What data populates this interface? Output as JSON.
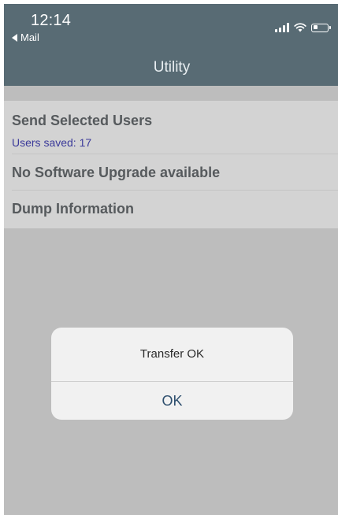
{
  "status_bar": {
    "time": "12:14",
    "back_app": "Mail",
    "battery_level": 0.3,
    "icons": [
      "signal-icon",
      "wifi-icon",
      "battery-icon",
      "back-triangle-icon"
    ]
  },
  "nav": {
    "title": "Utility"
  },
  "menu": {
    "items": [
      {
        "label": "Send Selected Users",
        "subtitle": "Users saved: 17"
      },
      {
        "label": "No Software Upgrade available"
      },
      {
        "label": "Dump Information"
      }
    ]
  },
  "alert": {
    "message": "Transfer OK",
    "button_label": "OK"
  },
  "colors": {
    "header_bg": "#586b74",
    "screen_bg": "#bdbdbd",
    "menu_bg": "#d3d3d3",
    "subtitle": "#3b3a9a",
    "alert_button": "#2e4f6e"
  }
}
